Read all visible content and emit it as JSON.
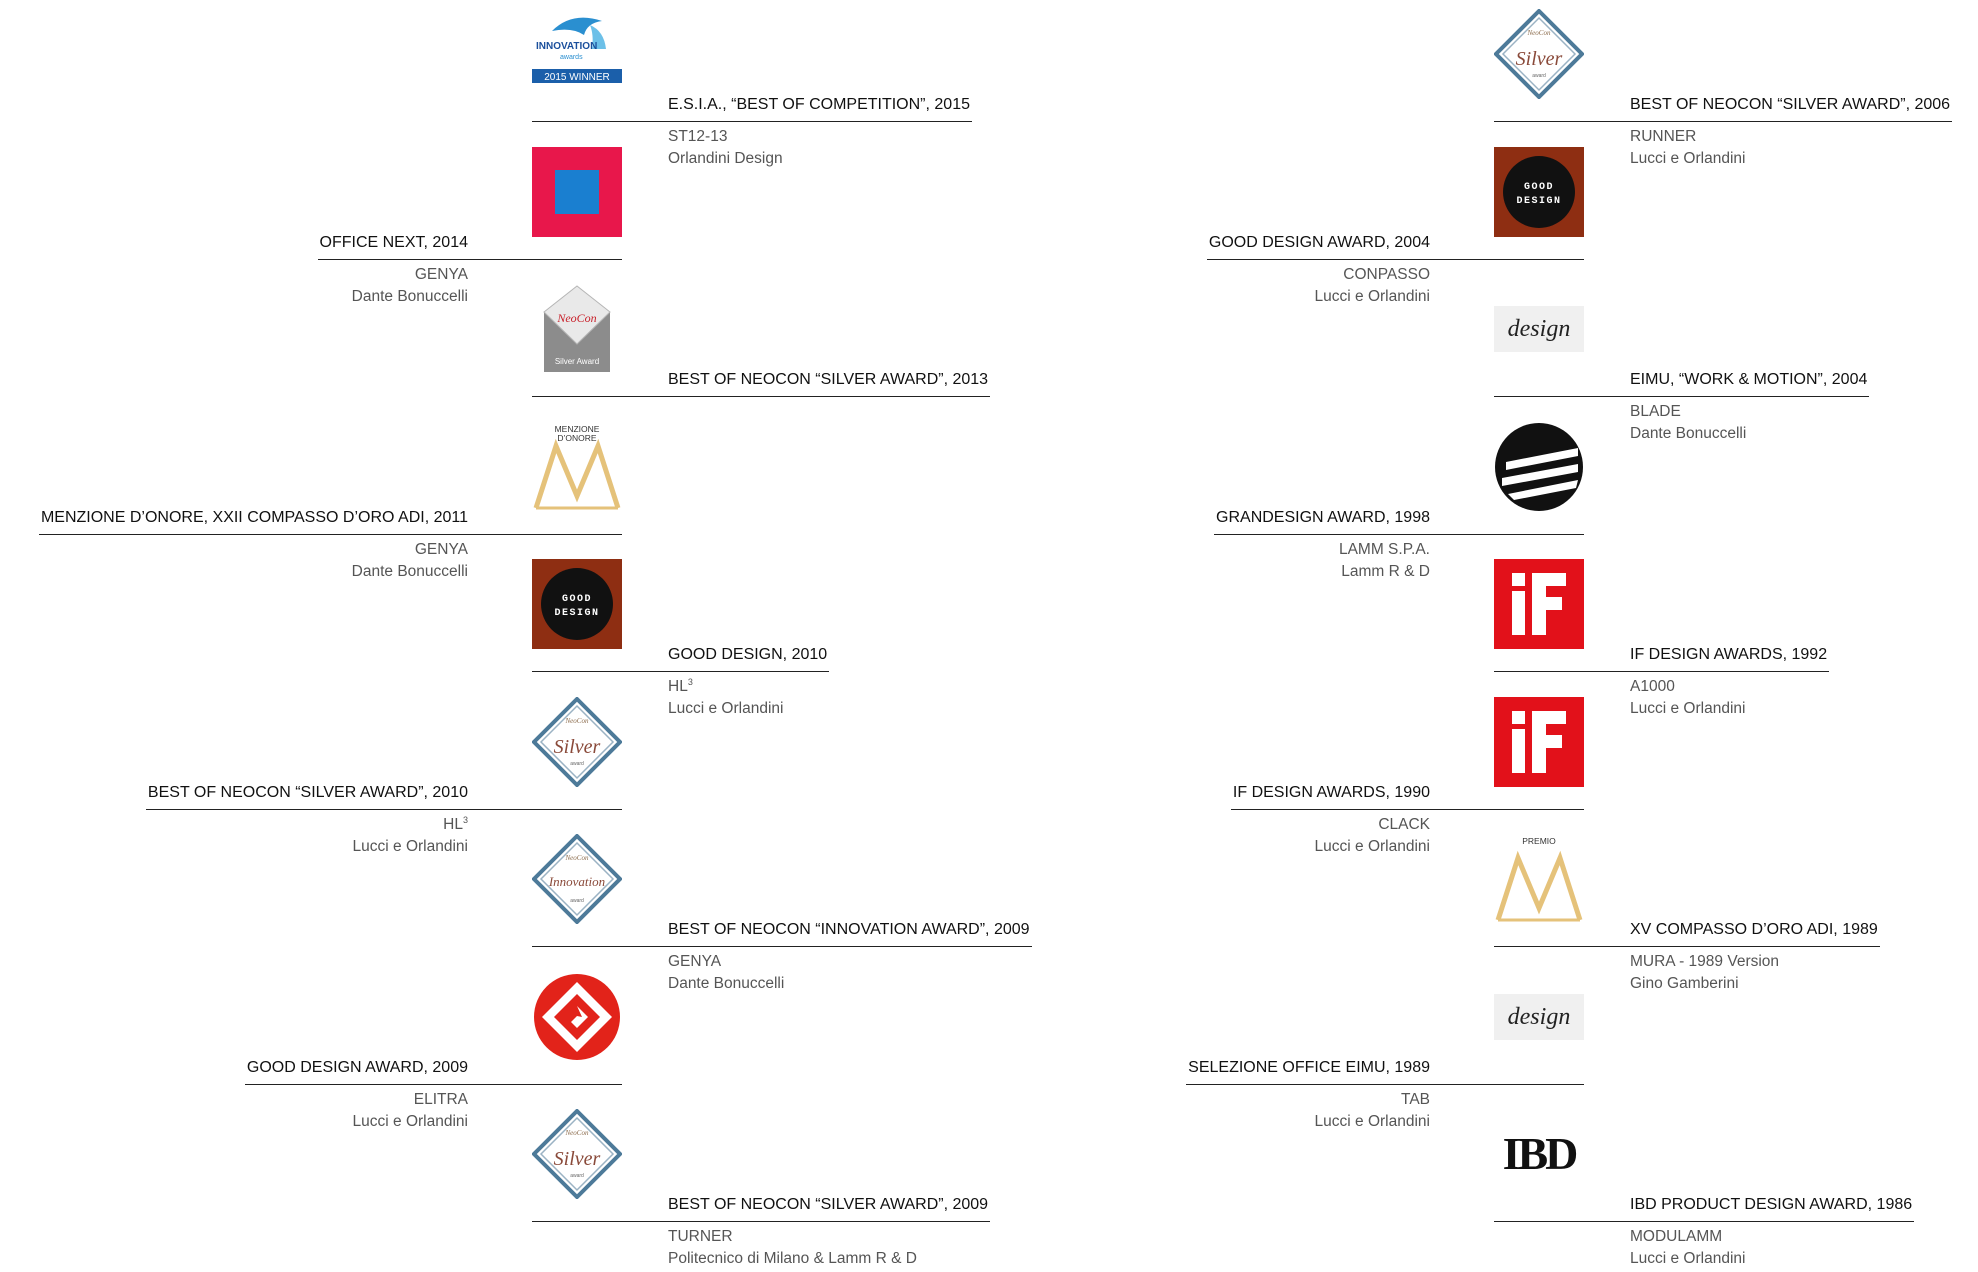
{
  "colors": {
    "text": "#111111",
    "subtext": "#555555",
    "rule": "#222222",
    "if_red": "#e2111a",
    "good_brown": "#8e2e12",
    "neocon_blue": "#4d7a99",
    "compasso_gold": "#e5c27a"
  },
  "left_column": [
    {
      "title": "E.S.I.A., “BEST OF COMPETITION”, 2015",
      "product": "ST12-13",
      "designer": "Orlandini Design",
      "logo": "innovation-award-icon",
      "logo_text": {
        "line1": "INNOVATION",
        "line2": "2015 WINNER"
      }
    },
    {
      "title": "OFFICE NEXT, 2014",
      "product": "GENYA",
      "designer": "Dante Bonuccelli",
      "logo": "office-next-icon"
    },
    {
      "title": "BEST OF NEOCON “SILVER AWARD”, 2013",
      "product": "",
      "designer": "",
      "logo": "neocon-silver-2013-icon",
      "logo_text": {
        "line1": "NeoCon",
        "line2": "Silver Award"
      }
    },
    {
      "title": "MENZIONE D’ONORE, XXII COMPASSO D’ORO ADI, 2011",
      "product": "GENYA",
      "designer": "Dante Bonuccelli",
      "logo": "compasso-doro-icon",
      "logo_text": {
        "line1": "MENZIONE",
        "line2": "D’ONORE"
      }
    },
    {
      "title": "GOOD DESIGN, 2010",
      "product": "HL",
      "product_sup": "3",
      "designer": "Lucci e Orlandini",
      "logo": "good-design-icon",
      "logo_text": {
        "line1": "GOOD",
        "line2": "DESIGN"
      }
    },
    {
      "title": "BEST OF NEOCON “SILVER AWARD”, 2010",
      "product": "HL",
      "product_sup": "3",
      "designer": "Lucci e Orlandini",
      "logo": "neocon-silver-icon",
      "logo_text": {
        "line1": "Silver"
      }
    },
    {
      "title": "BEST OF NEOCON “INNOVATION AWARD”, 2009",
      "product": "GENYA",
      "designer": "Dante Bonuccelli",
      "logo": "neocon-innovation-icon",
      "logo_text": {
        "line1": "Innovation"
      }
    },
    {
      "title": "GOOD DESIGN AWARD, 2009",
      "product": "ELITRA",
      "designer": "Lucci e Orlandini",
      "logo": "g-mark-icon"
    },
    {
      "title": "BEST OF NEOCON “SILVER AWARD”, 2009",
      "product": "TURNER",
      "designer": "Politecnico di Milano & Lamm R & D",
      "logo": "neocon-silver-icon",
      "logo_text": {
        "line1": "Silver"
      }
    }
  ],
  "right_column": [
    {
      "title": "BEST OF NEOCON “SILVER AWARD”, 2006",
      "product": "RUNNER",
      "designer": "Lucci e Orlandini",
      "logo": "neocon-silver-icon",
      "logo_text": {
        "line1": "Silver"
      }
    },
    {
      "title": "GOOD DESIGN AWARD, 2004",
      "product": "CONPASSO",
      "designer": "Lucci e Orlandini",
      "logo": "good-design-icon",
      "logo_text": {
        "line1": "GOOD",
        "line2": "DESIGN"
      }
    },
    {
      "title": "EIMU, “WORK & MOTION”, 2004",
      "product": "BLADE",
      "designer": "Dante Bonuccelli",
      "logo": "eimu-design-icon",
      "logo_text": {
        "line1": "design"
      }
    },
    {
      "title": "GRANDESIGN AWARD, 1998",
      "product": "LAMM S.P.A.",
      "designer": "Lamm R & D",
      "logo": "grandesign-icon"
    },
    {
      "title": "IF DESIGN AWARDS, 1992",
      "product": "A1000",
      "designer": "Lucci e Orlandini",
      "logo": "if-design-icon"
    },
    {
      "title": "IF DESIGN AWARDS, 1990",
      "product": "CLACK",
      "designer": "Lucci e Orlandini",
      "logo": "if-design-icon"
    },
    {
      "title": "XV COMPASSO D’ORO ADI, 1989",
      "product": "MURA - 1989 Version",
      "designer": "Gino Gamberini",
      "logo": "compasso-doro-icon",
      "logo_text": {
        "line1": "PREMIO"
      }
    },
    {
      "title": "SELEZIONE OFFICE EIMU, 1989",
      "product": "TAB",
      "designer": "Lucci e Orlandini",
      "logo": "eimu-design-icon",
      "logo_text": {
        "line1": "design"
      }
    },
    {
      "title": "IBD PRODUCT DESIGN AWARD, 1986",
      "product": "MODULAMM",
      "designer": "Lucci e Orlandini",
      "logo": "ibd-icon",
      "logo_text": {
        "line1": "IBD"
      }
    }
  ]
}
